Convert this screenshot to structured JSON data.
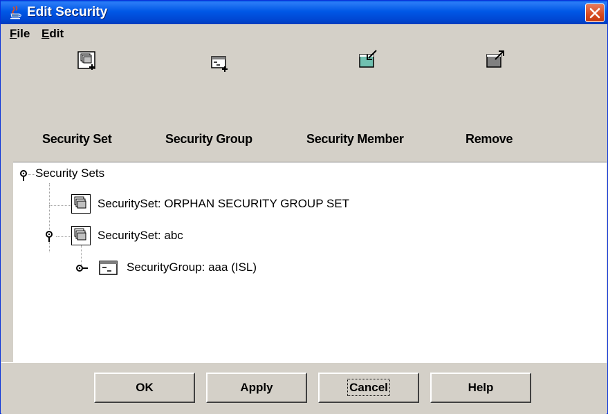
{
  "window": {
    "title": "Edit Security"
  },
  "menu": [
    {
      "label": "File"
    },
    {
      "label": "Edit"
    }
  ],
  "toolbar": [
    {
      "label": "Security Set",
      "icon": "security-set-add-icon"
    },
    {
      "label": "Security Group",
      "icon": "security-group-add-icon"
    },
    {
      "label": "Security Member",
      "icon": "security-member-add-icon"
    },
    {
      "label": "Remove",
      "icon": "remove-icon"
    }
  ],
  "tree": {
    "root": "Security Sets",
    "nodes": [
      {
        "label": "SecuritySet: ORPHAN SECURITY GROUP SET",
        "type": "security-set"
      },
      {
        "label": "SecuritySet: abc",
        "type": "security-set"
      },
      {
        "label": "SecurityGroup: aaa (ISL)",
        "type": "security-group"
      }
    ]
  },
  "buttons": [
    {
      "label": "OK"
    },
    {
      "label": "Apply"
    },
    {
      "label": "Cancel"
    },
    {
      "label": "Help"
    }
  ],
  "colors": {
    "titlebar": "#0058e6",
    "close": "#d84a20",
    "dialog": "#d4d0c8"
  }
}
